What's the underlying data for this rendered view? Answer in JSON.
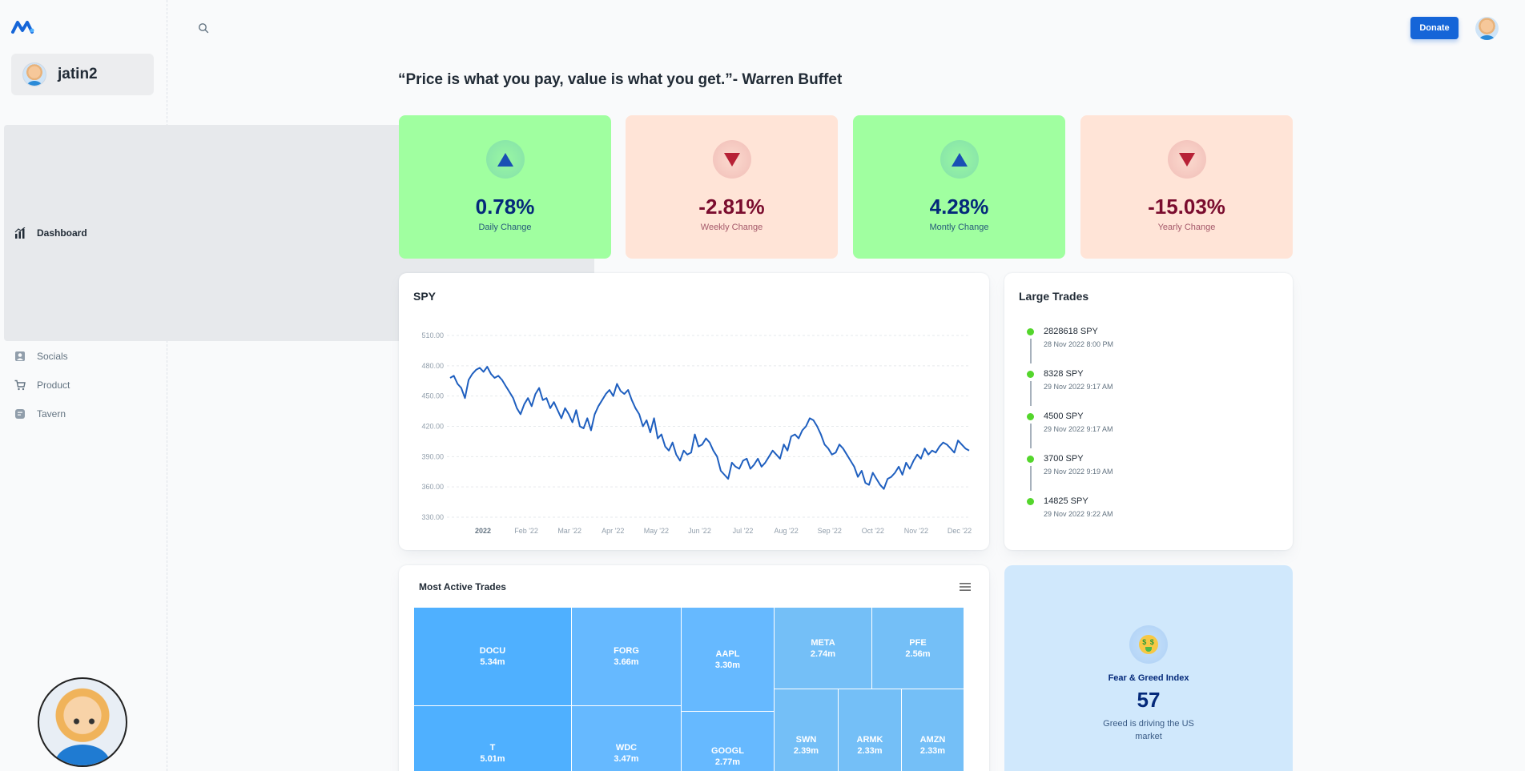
{
  "sidebar": {
    "account_name": "jatin2",
    "items": [
      {
        "label": "Dashboard",
        "icon": "dashboard-icon",
        "active": true
      },
      {
        "label": "Socials",
        "icon": "user-icon",
        "active": false
      },
      {
        "label": "Product",
        "icon": "cart-icon",
        "active": false
      },
      {
        "label": "Tavern",
        "icon": "chat-icon",
        "active": false
      }
    ]
  },
  "header": {
    "donate_label": "Donate"
  },
  "quote": "“Price is what you pay, value is what you get.”- Warren Buffet",
  "stats": [
    {
      "value": "0.78%",
      "label": "Daily Change",
      "direction": "up"
    },
    {
      "value": "-2.81%",
      "label": "Weekly Change",
      "direction": "down"
    },
    {
      "value": "4.28%",
      "label": "Montly Change",
      "direction": "up"
    },
    {
      "value": "-15.03%",
      "label": "Yearly Change",
      "direction": "down"
    }
  ],
  "colors": {
    "up_bg": "#a0ffa0",
    "down_bg": "#ffe4d7",
    "line": "#1f5fbf",
    "primary": "#1565d8",
    "timeline_dot": "#54d62c"
  },
  "spy": {
    "title": "SPY"
  },
  "chart_data": {
    "type": "line",
    "title": "SPY",
    "y_ticks": [
      "510.00",
      "480.00",
      "450.00",
      "420.00",
      "390.00",
      "360.00",
      "330.00"
    ],
    "x_ticks": [
      "2022",
      "Feb '22",
      "Mar '22",
      "Apr '22",
      "May '22",
      "Jun '22",
      "Jul '22",
      "Aug '22",
      "Sep '22",
      "Oct '22",
      "Nov '22",
      "Dec '22"
    ],
    "ylim": [
      330,
      510
    ],
    "grid": true,
    "series": [
      {
        "values": [
          468,
          470,
          462,
          458,
          448,
          466,
          472,
          476,
          478,
          474,
          479,
          472,
          468,
          470,
          466,
          460,
          454,
          448,
          438,
          432,
          442,
          448,
          440,
          452,
          458,
          446,
          448,
          438,
          444,
          436,
          428,
          438,
          432,
          424,
          436,
          420,
          418,
          428,
          416,
          432,
          440,
          446,
          452,
          456,
          450,
          462,
          455,
          452,
          456,
          446,
          438,
          432,
          420,
          426,
          414,
          428,
          408,
          412,
          400,
          396,
          404,
          392,
          386,
          396,
          392,
          394,
          412,
          400,
          402,
          408,
          404,
          396,
          390,
          376,
          372,
          368,
          384,
          380,
          378,
          386,
          388,
          378,
          382,
          388,
          380,
          384,
          390,
          396,
          392,
          388,
          402,
          396,
          410,
          412,
          408,
          416,
          420,
          428,
          426,
          420,
          412,
          402,
          398,
          392,
          394,
          402,
          398,
          392,
          386,
          380,
          370,
          376,
          364,
          362,
          374,
          368,
          362,
          358,
          368,
          370,
          374,
          380,
          372,
          384,
          378,
          386,
          392,
          388,
          398,
          392,
          396,
          394,
          400,
          404,
          402,
          398,
          394,
          406,
          402,
          398,
          396
        ]
      }
    ]
  },
  "trades": {
    "title": "Large Trades",
    "items": [
      {
        "main": "2828618 SPY",
        "time": "28 Nov 2022 8:00 PM"
      },
      {
        "main": "8328 SPY",
        "time": "29 Nov 2022 9:17 AM"
      },
      {
        "main": "4500 SPY",
        "time": "29 Nov 2022 9:17 AM"
      },
      {
        "main": "3700 SPY",
        "time": "29 Nov 2022 9:19 AM"
      },
      {
        "main": "14825 SPY",
        "time": "29 Nov 2022 9:22 AM"
      }
    ]
  },
  "most_active": {
    "title": "Most Active Trades",
    "tiles": [
      {
        "symbol": "DOCU",
        "value": "5.34m"
      },
      {
        "symbol": "FORG",
        "value": "3.66m"
      },
      {
        "symbol": "AAPL",
        "value": "3.30m"
      },
      {
        "symbol": "META",
        "value": "2.74m"
      },
      {
        "symbol": "PFE",
        "value": "2.56m"
      },
      {
        "symbol": "T",
        "value": "5.01m"
      },
      {
        "symbol": "WDC",
        "value": "3.47m"
      },
      {
        "symbol": "GOOGL",
        "value": "2.77m"
      },
      {
        "symbol": "SWN",
        "value": "2.39m"
      },
      {
        "symbol": "ARMK",
        "value": "2.33m"
      },
      {
        "symbol": "AMZN",
        "value": "2.33m"
      }
    ]
  },
  "fear_greed": {
    "title": "Fear & Greed Index",
    "value": "57",
    "description": "Greed is driving the US market",
    "icon": "money-face-icon"
  }
}
